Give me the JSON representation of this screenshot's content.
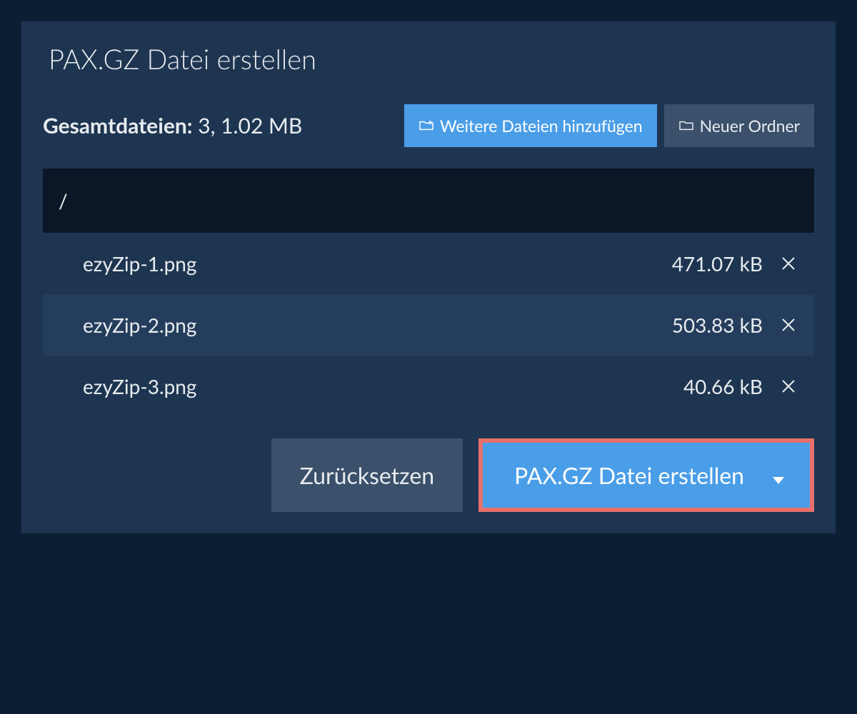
{
  "tab": {
    "title": "PAX.GZ Datei erstellen"
  },
  "summary": {
    "label": "Gesamtdateien:",
    "value": "3, 1.02 MB"
  },
  "toolbar": {
    "add_files_label": "Weitere Dateien hinzufügen",
    "new_folder_label": "Neuer Ordner"
  },
  "path": "/",
  "files": [
    {
      "name": "ezyZip-1.png",
      "size": "471.07 kB"
    },
    {
      "name": "ezyZip-2.png",
      "size": "503.83 kB"
    },
    {
      "name": "ezyZip-3.png",
      "size": "40.66 kB"
    }
  ],
  "footer": {
    "reset_label": "Zurücksetzen",
    "create_label": "PAX.GZ Datei erstellen"
  }
}
